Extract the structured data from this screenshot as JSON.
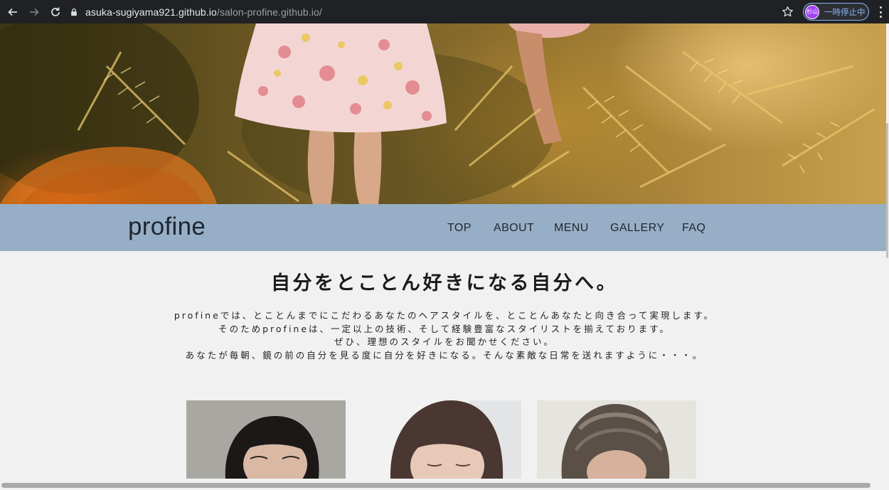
{
  "browser": {
    "url_host": "asuka-sugiyama921.github.io",
    "url_path": "/salon-profine.github.io/",
    "profile_initials": "杉山",
    "profile_status": "一時停止中"
  },
  "site": {
    "logo": "profine",
    "nav": [
      "TOP",
      "ABOUT",
      "MENU",
      "GALLERY",
      "FAQ"
    ]
  },
  "intro": {
    "headline": "自分をとことん好きになる自分へ。",
    "lines": [
      "profineでは、とことんまでにこだわるあなたのヘアスタイルを、とことんあなたと向き合って実現します。",
      "そのためprofineは、一定以上の技術、そして経験豊富なスタイリストを揃えております。",
      "ぜひ、理想のスタイルをお聞かせください。",
      "あなたが毎朝、鏡の前の自分を見る度に自分を好きになる。そんな素敵な日常を送れますように・・・。"
    ]
  },
  "gallery": {
    "photos": [
      "model-photo-1",
      "model-photo-2",
      "model-photo-3"
    ]
  }
}
